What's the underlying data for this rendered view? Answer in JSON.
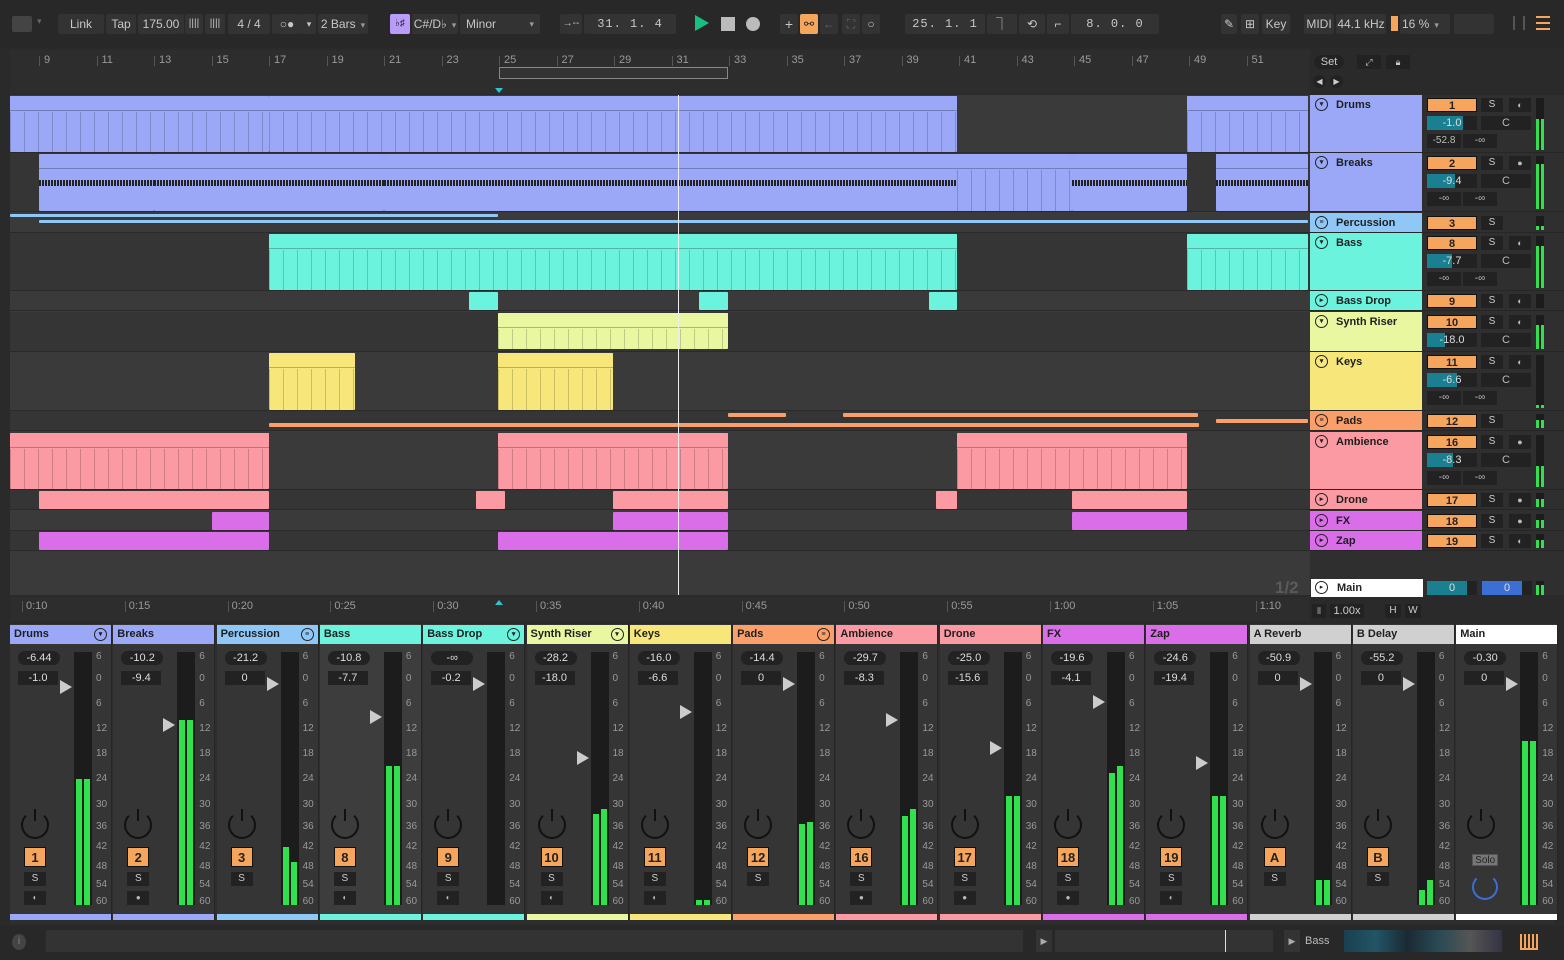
{
  "topbar": {
    "link": "Link",
    "tap": "Tap",
    "tempo": "175.00",
    "nudge_down": "||||",
    "nudge_up": "||||",
    "signature": "4 / 4",
    "metronome": "○●",
    "quantize": "2 Bars",
    "scale_toggle": "♭♯",
    "key": "C#/D♭",
    "scale": "Minor",
    "follow_icon": "→--",
    "position": "31.  1.  4",
    "play_icon": "▶",
    "stop_icon": "■",
    "record_icon": "●",
    "add_icon": "+",
    "automation_arm_icon": "⚯",
    "back_icon": "←",
    "capture_icon": "⛶",
    "loop_icon": "○",
    "loop_start": "25.  1.  1",
    "punch_in_icon": "⏋",
    "loop_toggle_icon": "⟲",
    "punch_out_icon": "⌐",
    "loop_length": "8.  0.  0",
    "draw_icon": "✎",
    "keyboard_icon": "⊞",
    "key_map": "Key",
    "midi_map": "MIDI",
    "sample_rate": "44.1 kHz",
    "cpu": "16 %",
    "accent": "#f5a55c"
  },
  "ruler": {
    "bars": [
      "9",
      "11",
      "13",
      "15",
      "17",
      "19",
      "21",
      "23",
      "25",
      "27",
      "29",
      "31",
      "33",
      "35",
      "37",
      "39",
      "41",
      "43",
      "45",
      "47",
      "49",
      "51"
    ],
    "set_label": "Set",
    "page_indicator": "1/2"
  },
  "time_ruler": {
    "labels": [
      "0:10",
      "0:15",
      "0:20",
      "0:25",
      "0:30",
      "0:35",
      "0:40",
      "0:45",
      "0:50",
      "0:55",
      "1:00",
      "1:05",
      "1:10"
    ],
    "zoom": "1.00x",
    "h": "H",
    "w": "W"
  },
  "tracks": [
    {
      "name": "Drums",
      "num": "1",
      "color": "#9aa8f7",
      "vol": "-1.0",
      "vol_fill": 0.72,
      "pan": "C",
      "send_a": "-52.8",
      "send_b": "-∞",
      "icon": "▾",
      "mon": "◐",
      "meter": [
        0.6,
        0.6
      ]
    },
    {
      "name": "Breaks",
      "num": "2",
      "color": "#9aa8f7",
      "vol": "-9.4",
      "vol_fill": 0.55,
      "pan": "C",
      "send_a": "-∞",
      "send_b": "-∞",
      "icon": "▾",
      "mon": "●",
      "meter": [
        0.85,
        0.85
      ]
    },
    {
      "name": "Percussion",
      "num": "3",
      "color": "#8fc8f7",
      "icon": "≡",
      "meter": [
        0.3,
        0.3
      ]
    },
    {
      "name": "Bass",
      "num": "8",
      "color": "#6cf3de",
      "vol": "-7.7",
      "vol_fill": 0.5,
      "pan": "C",
      "send_a": "-∞",
      "send_b": "-∞",
      "icon": "▾",
      "mon": "◐",
      "meter": [
        0.8,
        0.8
      ]
    },
    {
      "name": "Bass Drop",
      "num": "9",
      "color": "#6cf3de",
      "icon": "▸",
      "mon": "◐",
      "meter": [
        0,
        0
      ]
    },
    {
      "name": "Synth Riser",
      "num": "10",
      "color": "#e9f7a1",
      "vol": "-18.0",
      "vol_fill": 0.35,
      "pan": "C",
      "icon": "▾",
      "mon": "◐",
      "meter": [
        0.7,
        0.7
      ]
    },
    {
      "name": "Keys",
      "num": "11",
      "color": "#f7e77a",
      "vol": "-6.6",
      "vol_fill": 0.6,
      "pan": "C",
      "send_a": "-∞",
      "send_b": "-∞",
      "icon": "▾",
      "mon": "◐",
      "meter": [
        0.05,
        0.05
      ]
    },
    {
      "name": "Pads",
      "num": "12",
      "color": "#fa9f6a",
      "icon": "≡",
      "meter": [
        0.55,
        0.55
      ]
    },
    {
      "name": "Ambience",
      "num": "16",
      "color": "#fc9aa4",
      "vol": "-8.3",
      "vol_fill": 0.52,
      "pan": "C",
      "send_a": "-∞",
      "send_b": "-∞",
      "icon": "▾",
      "mon": "●",
      "meter": [
        0.4,
        0.4
      ]
    },
    {
      "name": "Drone",
      "num": "17",
      "color": "#fc9aa4",
      "icon": "▸",
      "mon": "●",
      "meter": [
        0.55,
        0.55
      ]
    },
    {
      "name": "FX",
      "num": "18",
      "color": "#d96ee8",
      "icon": "▸",
      "mon": "●",
      "meter": [
        0.55,
        0.55
      ]
    },
    {
      "name": "Zap",
      "num": "19",
      "color": "#d96ee8",
      "icon": "▸",
      "mon": "◐",
      "meter": [
        0.55,
        0.55
      ]
    }
  ],
  "main_track": {
    "name": "Main",
    "vol": "0",
    "pan": "0",
    "icon": "▸"
  },
  "mixer": {
    "channels": [
      {
        "name": "Drums",
        "num": "1",
        "peak": "-6.44",
        "vol": "-1.0",
        "color": "#9aa8f7",
        "icon": "▾",
        "mon": "◐",
        "meter": [
          0.5,
          0.5
        ],
        "fader": 0.11
      },
      {
        "name": "Breaks",
        "num": "2",
        "peak": "-10.2",
        "vol": "-9.4",
        "color": "#9aa8f7",
        "icon": "",
        "mon": "●",
        "meter": [
          0.73,
          0.73
        ],
        "fader": 0.26
      },
      {
        "name": "Percussion",
        "num": "3",
        "peak": "-21.2",
        "vol": "0",
        "color": "#8fc8f7",
        "icon": "≡",
        "mon": "",
        "meter": [
          0.23,
          0.17
        ],
        "fader": 0.1
      },
      {
        "name": "Bass",
        "num": "8",
        "peak": "-10.8",
        "vol": "-7.7",
        "color": "#6cf3de",
        "icon": "",
        "mon": "◐",
        "meter": [
          0.55,
          0.55
        ],
        "fader": 0.23
      },
      {
        "name": "Bass Drop",
        "num": "9",
        "peak": "-∞",
        "vol": "-0.2",
        "color": "#6cf3de",
        "icon": "▾",
        "mon": "◐",
        "meter": [
          0,
          0
        ],
        "fader": 0.1
      },
      {
        "name": "Synth Riser",
        "num": "10",
        "peak": "-28.2",
        "vol": "-18.0",
        "color": "#e9f7a1",
        "icon": "▾",
        "mon": "◐",
        "meter": [
          0.36,
          0.38
        ],
        "fader": 0.39
      },
      {
        "name": "Keys",
        "num": "11",
        "peak": "-16.0",
        "vol": "-6.6",
        "color": "#f7e77a",
        "icon": "",
        "mon": "◐",
        "meter": [
          0.02,
          0.02
        ],
        "fader": 0.21
      },
      {
        "name": "Pads",
        "num": "12",
        "peak": "-14.4",
        "vol": "0",
        "color": "#fa9f6a",
        "icon": "≡",
        "mon": "",
        "meter": [
          0.32,
          0.33
        ],
        "fader": 0.1
      },
      {
        "name": "Ambience",
        "num": "16",
        "peak": "-29.7",
        "vol": "-8.3",
        "color": "#fc9aa4",
        "icon": "",
        "mon": "●",
        "meter": [
          0.35,
          0.38
        ],
        "fader": 0.24
      },
      {
        "name": "Drone",
        "num": "17",
        "peak": "-25.0",
        "vol": "-15.6",
        "color": "#fc9aa4",
        "icon": "",
        "mon": "●",
        "meter": [
          0.43,
          0.43
        ],
        "fader": 0.35
      },
      {
        "name": "FX",
        "num": "18",
        "peak": "-19.6",
        "vol": "-4.1",
        "color": "#d96ee8",
        "icon": "",
        "mon": "●",
        "meter": [
          0.52,
          0.55
        ],
        "fader": 0.17
      },
      {
        "name": "Zap",
        "num": "19",
        "peak": "-24.6",
        "vol": "-19.4",
        "color": "#d96ee8",
        "icon": "",
        "mon": "◐",
        "meter": [
          0.43,
          0.43
        ],
        "fader": 0.41
      },
      {
        "name": "A Reverb",
        "num": "A",
        "peak": "-50.9",
        "vol": "0",
        "color": "#d0d0d0",
        "icon": "",
        "mon": "",
        "meter": [
          0.1,
          0.1
        ],
        "fader": 0.1
      },
      {
        "name": "B Delay",
        "num": "B",
        "peak": "-55.2",
        "vol": "0",
        "color": "#d0d0d0",
        "icon": "",
        "mon": "",
        "meter": [
          0.06,
          0.1
        ],
        "fader": 0.1
      },
      {
        "name": "Main",
        "num": "",
        "peak": "-0.30",
        "vol": "0",
        "color": "#ffffff",
        "icon": "",
        "mon": "",
        "meter": [
          0.65,
          0.65
        ],
        "fader": 0.1,
        "solo": "Solo"
      }
    ],
    "scale": [
      "6",
      "0",
      "6",
      "12",
      "18",
      "24",
      "30",
      "36",
      "42",
      "48",
      "54",
      "60"
    ],
    "solo_label": "S"
  },
  "status": {
    "info_icon": "i",
    "device": "Bass"
  }
}
